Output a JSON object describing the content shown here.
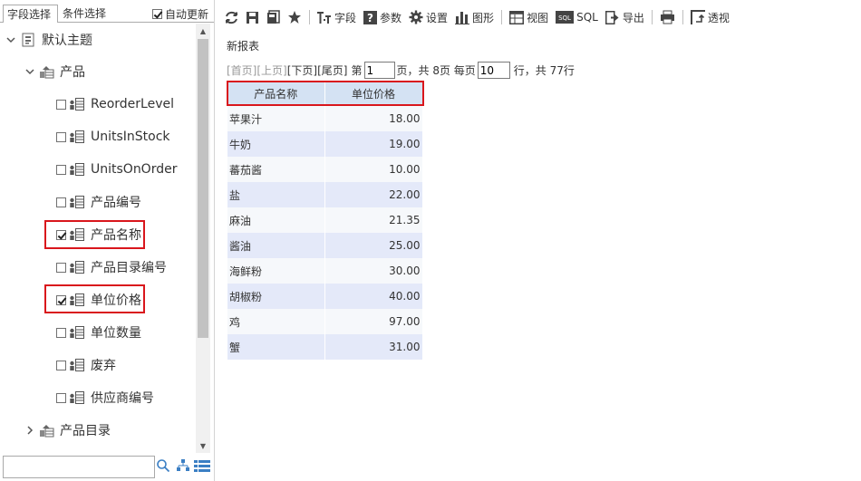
{
  "tabs": {
    "field_select": "字段选择",
    "condition_select": "条件选择",
    "auto_refresh_label": "自动更新",
    "auto_refresh_checked": true
  },
  "tree": {
    "root": {
      "label": "默认主题",
      "icon": "theme-icon",
      "expanded": true
    },
    "group": {
      "label": "产品",
      "icon": "table-icon",
      "expanded": true
    },
    "fields": [
      {
        "label": "ReorderLevel",
        "checked": false
      },
      {
        "label": "UnitsInStock",
        "checked": false
      },
      {
        "label": "UnitsOnOrder",
        "checked": false
      },
      {
        "label": "产品编号",
        "checked": false
      },
      {
        "label": "产品名称",
        "checked": true
      },
      {
        "label": "产品目录编号",
        "checked": false
      },
      {
        "label": "单位价格",
        "checked": true
      },
      {
        "label": "单位数量",
        "checked": false
      },
      {
        "label": "废弃",
        "checked": false
      },
      {
        "label": "供应商编号",
        "checked": false
      }
    ],
    "collapsed_group": {
      "label": "产品目录",
      "icon": "table-icon",
      "expanded": false
    }
  },
  "search": {
    "value": "",
    "placeholder": ""
  },
  "toolbar": {
    "field": "字段",
    "param": "参数",
    "settings": "设置",
    "chart": "图形",
    "view": "视图",
    "sql_icon_text": "SQL",
    "sql": "SQL",
    "export": "导出",
    "pivot": "透视"
  },
  "report": {
    "title": "新报表",
    "pager": {
      "first": "[首页]",
      "prev": "[上页]",
      "next": "[下页]",
      "last": "[尾页]",
      "page_prefix": "第",
      "page_value": "1",
      "page_suffix": "页，共 8页 每页",
      "page_size": "10",
      "rows_suffix": "行，共 77行"
    },
    "columns": [
      "产品名称",
      "单位价格"
    ],
    "rows": [
      {
        "name": "苹果汁",
        "price": "18.00"
      },
      {
        "name": "牛奶",
        "price": "19.00"
      },
      {
        "name": "蕃茄酱",
        "price": "10.00"
      },
      {
        "name": "盐",
        "price": "22.00"
      },
      {
        "name": "麻油",
        "price": "21.35"
      },
      {
        "name": "酱油",
        "price": "25.00"
      },
      {
        "name": "海鲜粉",
        "price": "30.00"
      },
      {
        "name": "胡椒粉",
        "price": "40.00"
      },
      {
        "name": "鸡",
        "price": "97.00"
      },
      {
        "name": "蟹",
        "price": "31.00"
      }
    ]
  },
  "colors": {
    "highlight": "#d9161c",
    "header_bg": "#d4e2f3",
    "row_alt": "#e4e9f9"
  }
}
